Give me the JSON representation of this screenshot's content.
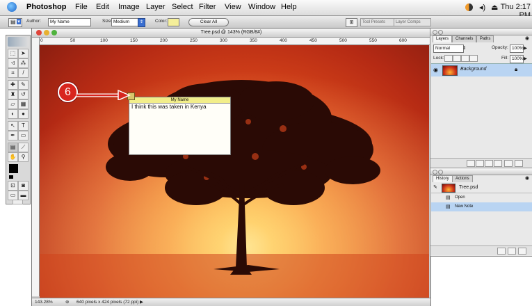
{
  "menubar": {
    "app_name": "Photoshop",
    "menus": [
      "File",
      "Edit",
      "Image",
      "Layer",
      "Select",
      "Filter",
      "View",
      "Window",
      "Help"
    ],
    "clock": "Thu 2:17 PM"
  },
  "options_bar": {
    "author_label": "Author:",
    "author_value": "My Name",
    "size_label": "Size:",
    "size_value": "Medium",
    "color_label": "Color:",
    "color_swatch": "#f5ef9a",
    "clear_all_label": "Clear All",
    "tab_tool_presets": "Tool Presets",
    "tab_layer_comps": "Layer Comps"
  },
  "document": {
    "title": "Tree.psd @ 143% (RGB/8#)",
    "zoom": "143.28%",
    "doc_info": "640 pixels x 424 pixels (72 ppi)",
    "ruler_ticks": [
      "0",
      "50",
      "100",
      "150",
      "200",
      "250",
      "300",
      "350",
      "400",
      "450",
      "500",
      "550",
      "600"
    ]
  },
  "note": {
    "author": "My Name",
    "text": "I think this was taken in Kenya"
  },
  "callout": {
    "number": "6",
    "color": "#d8251e"
  },
  "layers_panel": {
    "tabs": [
      "Layers",
      "Channels",
      "Paths"
    ],
    "blend_mode": "Normal",
    "opacity_label": "Opacity:",
    "opacity_value": "100%",
    "lock_label": "Lock:",
    "fill_label": "Fill:",
    "fill_value": "100%",
    "layer_name": "Background"
  },
  "history_panel": {
    "tabs": [
      "History",
      "Actions"
    ],
    "snapshot": "Tree.psd",
    "states": [
      "Open",
      "New Note"
    ]
  },
  "colors": {
    "selection": "#b9d4f2",
    "note_header": "#f2ee8a"
  }
}
